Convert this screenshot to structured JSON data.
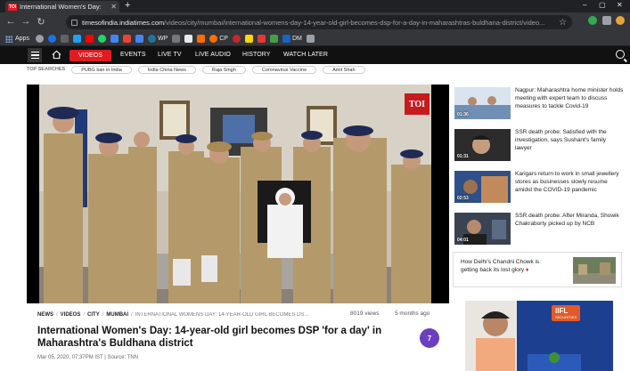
{
  "browser": {
    "tab_title": "International Women's Day:",
    "tab_favicon": "TOI",
    "url_host": "timesofindia.indiatimes.com",
    "url_path": "/videos/city/mumbai/international-womens-day-14-year-old-girl-becomes-dsp-for-a-day-in-maharashtras-buldhana-district/video...",
    "bookmarks": {
      "apps": "Apps",
      "wp": "WP",
      "cp": "CP",
      "dm": "DM"
    }
  },
  "site_nav": {
    "items": [
      "VIDEOS",
      "LIVE TV",
      "LIVE AUDIO",
      "HISTORY",
      "WATCH LATER"
    ],
    "events": "EVENTS"
  },
  "top_searches": {
    "label": "TOP SEARCHES",
    "chips": [
      "PUBG ban in India",
      "India China News",
      "Raja Singh",
      "Coronavirus Vaccine",
      "Amit Shah"
    ]
  },
  "video": {
    "logo": "TOI"
  },
  "article": {
    "breadcrumb": [
      "NEWS",
      "VIDEOS",
      "CITY",
      "MUMBAI"
    ],
    "trail": "INTERNATIONAL WOMENS DAY: 14-YEAR-OLD GIRL BECOMES DS...",
    "views": "8019 views",
    "ago": "5 months ago",
    "headline": "International Women's Day: 14-year-old girl becomes DSP 'for a day' in Maharashtra's Buldhana district",
    "badge": "7",
    "date": "Mar 05, 2020, 07:37PM IST",
    "source": "Source: TNN"
  },
  "rail": [
    {
      "duration": "01:36",
      "title": "Nagpur: Maharashtra home minister holds meeting with expert team to discuss measures to tackle Covid-19"
    },
    {
      "duration": "01:31",
      "title": "SSR death probe: Satisfied with the investigation, says Sushant's family lawyer"
    },
    {
      "duration": "02:53",
      "title": "Karigars return to work in small jewellery stores as businesses slowly resume amidst the COVID-19 pandemic"
    },
    {
      "duration": "04:01",
      "title": "SSR death probe: After Miranda, Showik Chakraborty picked up by NCB"
    }
  ],
  "sponsored": {
    "title": "How Delhi's Chandni Chowk is getting back its lost glory",
    "marker": "♦"
  },
  "ad": {
    "brand": "IIFL",
    "brand_sub": "SECURITIES"
  },
  "colors": {
    "accent": "#e21b22",
    "nav_bg": "#111111",
    "badge": "#6c3fc1"
  }
}
